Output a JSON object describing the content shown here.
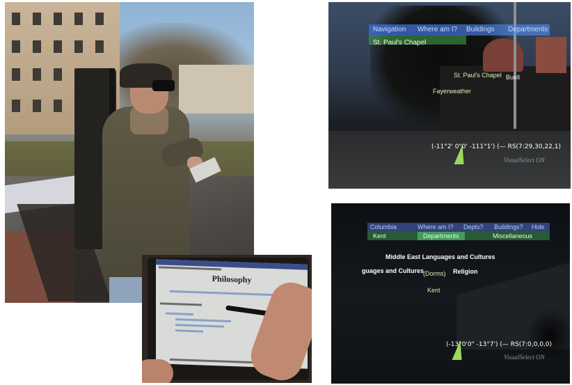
{
  "ar_top": {
    "menu_labels": [
      "Navigation",
      "Where am I?",
      "Buildings",
      "Departments"
    ],
    "submenu_label": "St. Paul's Chapel",
    "labels": [
      "St. Paul's Chapel",
      "Buell",
      "Fayerweather"
    ],
    "coords": "(-11°2' 0\"0' -111°1') (— RS(7:29,30,22,1)",
    "status": "VisualSelect ON",
    "cone_color": "#9bd95c"
  },
  "tablet": {
    "page_title": "Philosophy"
  },
  "ar_bottom": {
    "menu_labels": [
      "Columbia",
      "Where am I?",
      "Depts?",
      "Buildings?",
      "Hide"
    ],
    "submenu_labels": [
      "Kent",
      "Departments",
      "Miscellaneous"
    ],
    "labels": {
      "middle_east": "Middle East Languages and Cultures",
      "partial": "guages and Cultures",
      "dorms": "(Dorms)",
      "religion": "Religion",
      "kent": "Kent"
    },
    "coords": "(-13°0'0\" -13°7') (— RS(7:0,0,0,0)",
    "status": "VisualSelect ON"
  }
}
